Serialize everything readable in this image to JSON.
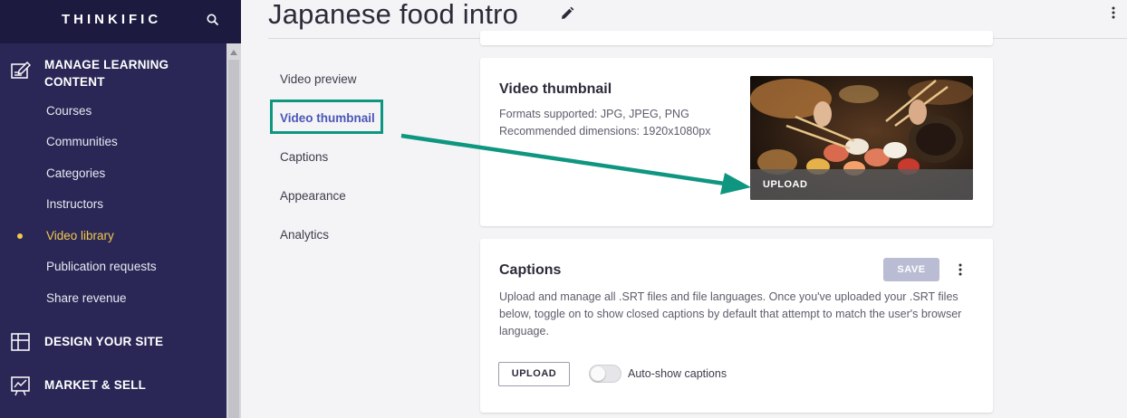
{
  "sidebar": {
    "brand": "THINKIFIC",
    "sections": {
      "manage_learning": "MANAGE LEARNING CONTENT",
      "design_site": "DESIGN YOUR SITE",
      "market_sell": "MARKET & SELL"
    },
    "items": [
      "Courses",
      "Communities",
      "Categories",
      "Instructors",
      "Video library",
      "Publication requests",
      "Share revenue"
    ],
    "active_item": "Video library",
    "active_color": "#f2c94c"
  },
  "header": {
    "title": "Japanese food intro"
  },
  "subnav": {
    "items": [
      "Video preview",
      "Video thumbnail",
      "Captions",
      "Appearance",
      "Analytics"
    ],
    "active": "Video thumbnail",
    "highlight_color": "#0e9680"
  },
  "thumbnail_card": {
    "title": "Video thumbnail",
    "formats": "Formats supported: JPG, JPEG, PNG",
    "dimensions": "Recommended dimensions: 1920x1080px",
    "upload_label": "UPLOAD"
  },
  "captions_card": {
    "title": "Captions",
    "save_label": "SAVE",
    "description": "Upload and manage all .SRT files and file languages. Once you've uploaded your .SRT files below, toggle on to show closed captions by default that attempt to match the user's browser language.",
    "upload_label": "UPLOAD",
    "toggle_label": "Auto-show captions",
    "toggle_on": false
  },
  "icons": {
    "search": "search-icon",
    "edit": "pencil-icon",
    "menu": "more-vertical-icon",
    "manage_learning": "edit-note-icon",
    "design_site": "layout-icon",
    "market_sell": "chart-icon"
  }
}
